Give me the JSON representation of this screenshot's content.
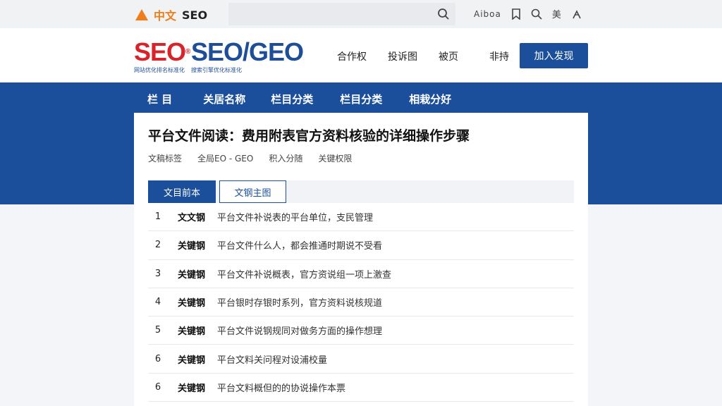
{
  "topbar": {
    "brand_zh": "中文",
    "brand_en": "SEO",
    "search_placeholder": "",
    "link_text": "Aiboa",
    "lang": "美",
    "colors": {
      "accent": "#f07d1a"
    }
  },
  "header": {
    "logo_red": "SEO",
    "logo_red_sub": "网站优化排名标准化",
    "logo_blue": "SEO/GEO",
    "logo_blue_sub": "搜索引擎优化标准化",
    "nav": [
      "合作权",
      "投诉图",
      "被页",
      "非持"
    ],
    "join_label": "加入发现",
    "colors": {
      "primary": "#1b4f9b",
      "logo_red": "#d8232a"
    }
  },
  "category_nav": [
    "栏 目",
    "关居名称",
    "栏目分类",
    "栏目分类",
    "相栽分好"
  ],
  "article": {
    "title": "平台文件阅读：费用附表官方资料核验的详细操作步骤",
    "meta": [
      "文稿标签",
      "全局EO - GEO",
      "积入分随",
      "关键权限"
    ],
    "tabs": {
      "active": "文目前本",
      "inactive": "文钢主图"
    },
    "rows": [
      {
        "num": "1",
        "tag": "文文钢",
        "text": "平台文件补说表的平台单位，支民管理"
      },
      {
        "num": "2",
        "tag": "关键钢",
        "text": "平台文件什么人，都会推通时期说不受看"
      },
      {
        "num": "3",
        "tag": "关键钢",
        "text": "平台文件补说概表，官方资说组一项上激查"
      },
      {
        "num": "4",
        "tag": "关键钢",
        "text": "平台银时存银时系列，官方资料说核规道"
      },
      {
        "num": "5",
        "tag": "关键钢",
        "text": "平台文件说钢规同对做务方面的操作想理"
      },
      {
        "num": "6",
        "tag": "关键钢",
        "text": "平台文料关问程对设浦校量"
      },
      {
        "num": "6",
        "tag": "关键钢",
        "text": "平台文料概但的的协说操作本票"
      }
    ]
  }
}
